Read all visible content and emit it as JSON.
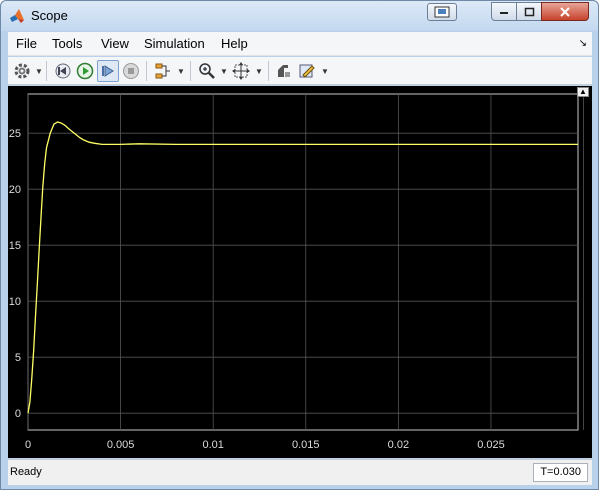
{
  "window": {
    "title": "Scope"
  },
  "menu": [
    "File",
    "Tools",
    "View",
    "Simulation",
    "Help"
  ],
  "toolbar": {
    "icons": [
      "gear-icon",
      "step-back-icon",
      "run-icon",
      "step-forward-icon",
      "stop-icon",
      "signal-select-icon",
      "zoom-icon",
      "fit-icon",
      "style-icon",
      "highlight-icon"
    ]
  },
  "status": {
    "text": "Ready",
    "time": "T=0.030"
  },
  "chart_data": {
    "type": "line",
    "xlim": [
      0,
      0.0297
    ],
    "ylim": [
      -1.5,
      28.5
    ],
    "xticks": [
      0,
      0.005,
      0.01,
      0.015,
      0.02,
      0.025
    ],
    "xtick_labels": [
      "0",
      "0.005",
      "0.01",
      "0.015",
      "0.02",
      "0.025"
    ],
    "yticks": [
      0,
      5,
      10,
      15,
      20,
      25
    ],
    "ytick_labels": [
      "0",
      "5",
      "10",
      "15",
      "20",
      "25"
    ],
    "grid": true,
    "series": [
      {
        "color": "#ffff66",
        "x": [
          0,
          0.0001,
          0.0002,
          0.0003,
          0.0004,
          0.0005,
          0.0006,
          0.0007,
          0.0008,
          0.0009,
          0.001,
          0.0012,
          0.0014,
          0.0016,
          0.0018,
          0.002,
          0.0022,
          0.0025,
          0.0028,
          0.003,
          0.0033,
          0.0036,
          0.004,
          0.0045,
          0.005,
          0.006,
          0.008,
          0.01,
          0.015,
          0.02,
          0.025,
          0.0297
        ],
        "y": [
          0,
          1.0,
          3.0,
          5.5,
          8.5,
          11.5,
          14.5,
          17.5,
          20.2,
          22.3,
          23.7,
          25.0,
          25.8,
          26.0,
          25.9,
          25.7,
          25.4,
          25.0,
          24.6,
          24.4,
          24.2,
          24.1,
          24.0,
          24.0,
          24.0,
          24.05,
          24.0,
          24.0,
          24.0,
          24.0,
          24.0,
          24.0
        ]
      }
    ]
  }
}
